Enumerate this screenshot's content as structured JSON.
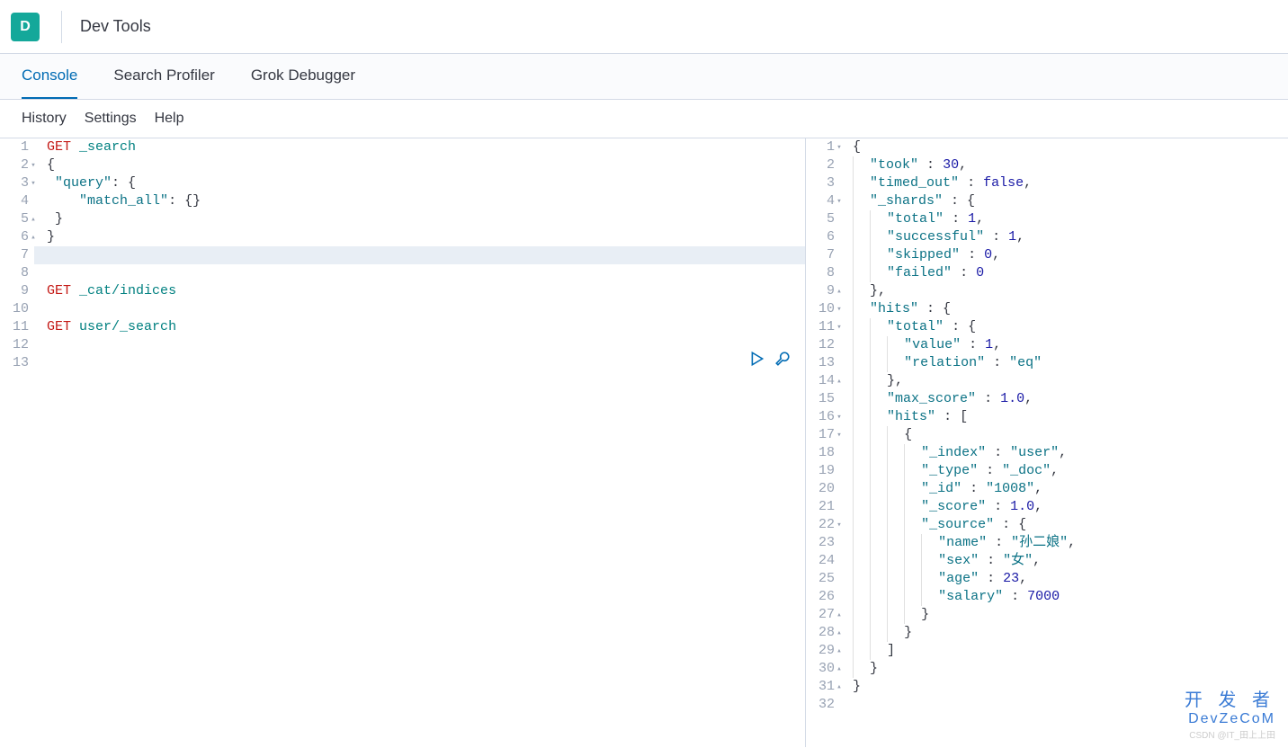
{
  "header": {
    "icon_letter": "D",
    "title": "Dev Tools"
  },
  "tabs": [
    {
      "label": "Console",
      "active": true
    },
    {
      "label": "Search Profiler",
      "active": false
    },
    {
      "label": "Grok Debugger",
      "active": false
    }
  ],
  "toolbar": [
    {
      "label": "History"
    },
    {
      "label": "Settings"
    },
    {
      "label": "Help"
    }
  ],
  "request_editor": {
    "active_line": 7,
    "lines": [
      {
        "n": 1,
        "tokens": [
          [
            "kw",
            "GET"
          ],
          [
            "",
            ""
          ],
          [
            "ident",
            "_search"
          ]
        ]
      },
      {
        "n": 2,
        "fold": "down",
        "tokens": [
          [
            "punc",
            "{"
          ]
        ]
      },
      {
        "n": 3,
        "fold": "down",
        "tokens": [
          [
            "",
            " "
          ],
          [
            "key",
            "\"query\""
          ],
          [
            "punc",
            ": {"
          ]
        ]
      },
      {
        "n": 4,
        "tokens": [
          [
            "",
            "    "
          ],
          [
            "key",
            "\"match_all\""
          ],
          [
            "punc",
            ": {}"
          ]
        ]
      },
      {
        "n": 5,
        "fold": "up",
        "tokens": [
          [
            "",
            " "
          ],
          [
            "punc",
            "}"
          ]
        ]
      },
      {
        "n": 6,
        "fold": "up",
        "tokens": [
          [
            "punc",
            "}"
          ]
        ]
      },
      {
        "n": 7,
        "tokens": []
      },
      {
        "n": 8,
        "tokens": []
      },
      {
        "n": 9,
        "tokens": [
          [
            "kw",
            "GET"
          ],
          [
            "",
            ""
          ],
          [
            "ident",
            "_cat/indices"
          ]
        ]
      },
      {
        "n": 10,
        "tokens": []
      },
      {
        "n": 11,
        "tokens": [
          [
            "kw",
            "GET"
          ],
          [
            "",
            ""
          ],
          [
            "ident",
            "user/_search"
          ]
        ]
      },
      {
        "n": 12,
        "tokens": []
      },
      {
        "n": 13,
        "tokens": []
      }
    ]
  },
  "response_editor": {
    "lines": [
      {
        "n": 1,
        "fold": "down",
        "indent": 0,
        "tokens": [
          [
            "punc",
            "{"
          ]
        ]
      },
      {
        "n": 2,
        "indent": 1,
        "tokens": [
          [
            "key",
            "\"took\""
          ],
          [
            "punc",
            " : "
          ],
          [
            "num",
            "30"
          ],
          [
            "punc",
            ","
          ]
        ]
      },
      {
        "n": 3,
        "indent": 1,
        "tokens": [
          [
            "key",
            "\"timed_out\""
          ],
          [
            "punc",
            " : "
          ],
          [
            "bool",
            "false"
          ],
          [
            "punc",
            ","
          ]
        ]
      },
      {
        "n": 4,
        "fold": "down",
        "indent": 1,
        "tokens": [
          [
            "key",
            "\"_shards\""
          ],
          [
            "punc",
            " : {"
          ]
        ]
      },
      {
        "n": 5,
        "indent": 2,
        "tokens": [
          [
            "key",
            "\"total\""
          ],
          [
            "punc",
            " : "
          ],
          [
            "num",
            "1"
          ],
          [
            "punc",
            ","
          ]
        ]
      },
      {
        "n": 6,
        "indent": 2,
        "tokens": [
          [
            "key",
            "\"successful\""
          ],
          [
            "punc",
            " : "
          ],
          [
            "num",
            "1"
          ],
          [
            "punc",
            ","
          ]
        ]
      },
      {
        "n": 7,
        "indent": 2,
        "tokens": [
          [
            "key",
            "\"skipped\""
          ],
          [
            "punc",
            " : "
          ],
          [
            "num",
            "0"
          ],
          [
            "punc",
            ","
          ]
        ]
      },
      {
        "n": 8,
        "indent": 2,
        "tokens": [
          [
            "key",
            "\"failed\""
          ],
          [
            "punc",
            " : "
          ],
          [
            "num",
            "0"
          ]
        ]
      },
      {
        "n": 9,
        "fold": "up",
        "indent": 1,
        "tokens": [
          [
            "punc",
            "},"
          ]
        ]
      },
      {
        "n": 10,
        "fold": "down",
        "indent": 1,
        "tokens": [
          [
            "key",
            "\"hits\""
          ],
          [
            "punc",
            " : {"
          ]
        ]
      },
      {
        "n": 11,
        "fold": "down",
        "indent": 2,
        "tokens": [
          [
            "key",
            "\"total\""
          ],
          [
            "punc",
            " : {"
          ]
        ]
      },
      {
        "n": 12,
        "indent": 3,
        "tokens": [
          [
            "key",
            "\"value\""
          ],
          [
            "punc",
            " : "
          ],
          [
            "num",
            "1"
          ],
          [
            "punc",
            ","
          ]
        ]
      },
      {
        "n": 13,
        "indent": 3,
        "tokens": [
          [
            "key",
            "\"relation\""
          ],
          [
            "punc",
            " : "
          ],
          [
            "str",
            "\"eq\""
          ]
        ]
      },
      {
        "n": 14,
        "fold": "up",
        "indent": 2,
        "tokens": [
          [
            "punc",
            "},"
          ]
        ]
      },
      {
        "n": 15,
        "indent": 2,
        "tokens": [
          [
            "key",
            "\"max_score\""
          ],
          [
            "punc",
            " : "
          ],
          [
            "num",
            "1.0"
          ],
          [
            "punc",
            ","
          ]
        ]
      },
      {
        "n": 16,
        "fold": "down",
        "indent": 2,
        "tokens": [
          [
            "key",
            "\"hits\""
          ],
          [
            "punc",
            " : ["
          ]
        ]
      },
      {
        "n": 17,
        "fold": "down",
        "indent": 3,
        "tokens": [
          [
            "punc",
            "{"
          ]
        ]
      },
      {
        "n": 18,
        "indent": 4,
        "tokens": [
          [
            "key",
            "\"_index\""
          ],
          [
            "punc",
            " : "
          ],
          [
            "str",
            "\"user\""
          ],
          [
            "punc",
            ","
          ]
        ]
      },
      {
        "n": 19,
        "indent": 4,
        "tokens": [
          [
            "key",
            "\"_type\""
          ],
          [
            "punc",
            " : "
          ],
          [
            "str",
            "\"_doc\""
          ],
          [
            "punc",
            ","
          ]
        ]
      },
      {
        "n": 20,
        "indent": 4,
        "tokens": [
          [
            "key",
            "\"_id\""
          ],
          [
            "punc",
            " : "
          ],
          [
            "str",
            "\"1008\""
          ],
          [
            "punc",
            ","
          ]
        ]
      },
      {
        "n": 21,
        "indent": 4,
        "tokens": [
          [
            "key",
            "\"_score\""
          ],
          [
            "punc",
            " : "
          ],
          [
            "num",
            "1.0"
          ],
          [
            "punc",
            ","
          ]
        ]
      },
      {
        "n": 22,
        "fold": "down",
        "indent": 4,
        "tokens": [
          [
            "key",
            "\"_source\""
          ],
          [
            "punc",
            " : {"
          ]
        ]
      },
      {
        "n": 23,
        "indent": 5,
        "tokens": [
          [
            "key",
            "\"name\""
          ],
          [
            "punc",
            " : "
          ],
          [
            "str",
            "\"孙二娘\""
          ],
          [
            "punc",
            ","
          ]
        ]
      },
      {
        "n": 24,
        "indent": 5,
        "tokens": [
          [
            "key",
            "\"sex\""
          ],
          [
            "punc",
            " : "
          ],
          [
            "str",
            "\"女\""
          ],
          [
            "punc",
            ","
          ]
        ]
      },
      {
        "n": 25,
        "indent": 5,
        "tokens": [
          [
            "key",
            "\"age\""
          ],
          [
            "punc",
            " : "
          ],
          [
            "num",
            "23"
          ],
          [
            "punc",
            ","
          ]
        ]
      },
      {
        "n": 26,
        "indent": 5,
        "tokens": [
          [
            "key",
            "\"salary\""
          ],
          [
            "punc",
            " : "
          ],
          [
            "num",
            "7000"
          ]
        ]
      },
      {
        "n": 27,
        "fold": "up",
        "indent": 4,
        "tokens": [
          [
            "punc",
            "}"
          ]
        ]
      },
      {
        "n": 28,
        "fold": "up",
        "indent": 3,
        "tokens": [
          [
            "punc",
            "}"
          ]
        ]
      },
      {
        "n": 29,
        "fold": "up",
        "indent": 2,
        "tokens": [
          [
            "punc",
            "]"
          ]
        ]
      },
      {
        "n": 30,
        "fold": "up",
        "indent": 1,
        "tokens": [
          [
            "punc",
            "}"
          ]
        ]
      },
      {
        "n": 31,
        "fold": "up",
        "indent": 0,
        "tokens": [
          [
            "punc",
            "}"
          ]
        ]
      },
      {
        "n": 32,
        "indent": 0,
        "tokens": []
      }
    ]
  },
  "watermark": {
    "line1": "开 发 者",
    "line2": "DevZeCoM",
    "line3": "CSDN @IT_田上上田"
  }
}
